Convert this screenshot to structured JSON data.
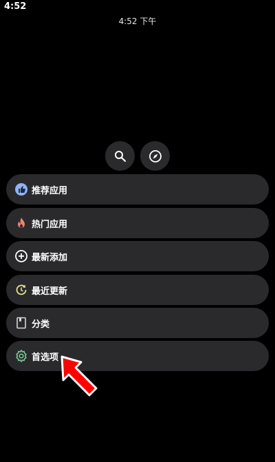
{
  "status_bar": {
    "time": "4:52"
  },
  "header": {
    "time_text": "4:52 下午"
  },
  "top_buttons": [
    {
      "icon": "search-icon"
    },
    {
      "icon": "compass-icon"
    }
  ],
  "menu": {
    "items": [
      {
        "label": "推荐应用",
        "icon": "thumbs-up-icon",
        "icon_color": "#8fb4f0"
      },
      {
        "label": "热门应用",
        "icon": "flame-icon",
        "icon_color": "#f0826b"
      },
      {
        "label": "最新添加",
        "icon": "add-circle-icon",
        "icon_color": "#ffffff"
      },
      {
        "label": "最近更新",
        "icon": "update-icon",
        "icon_color": "#e8e28a"
      },
      {
        "label": "分类",
        "icon": "category-icon",
        "icon_color": "#d8d8d8"
      },
      {
        "label": "首选项",
        "icon": "gear-icon",
        "icon_color": "#7fd39a"
      }
    ]
  },
  "colors": {
    "background": "#000000",
    "pill": "#2a2a2d",
    "annotation_arrow": "#ff0000"
  }
}
